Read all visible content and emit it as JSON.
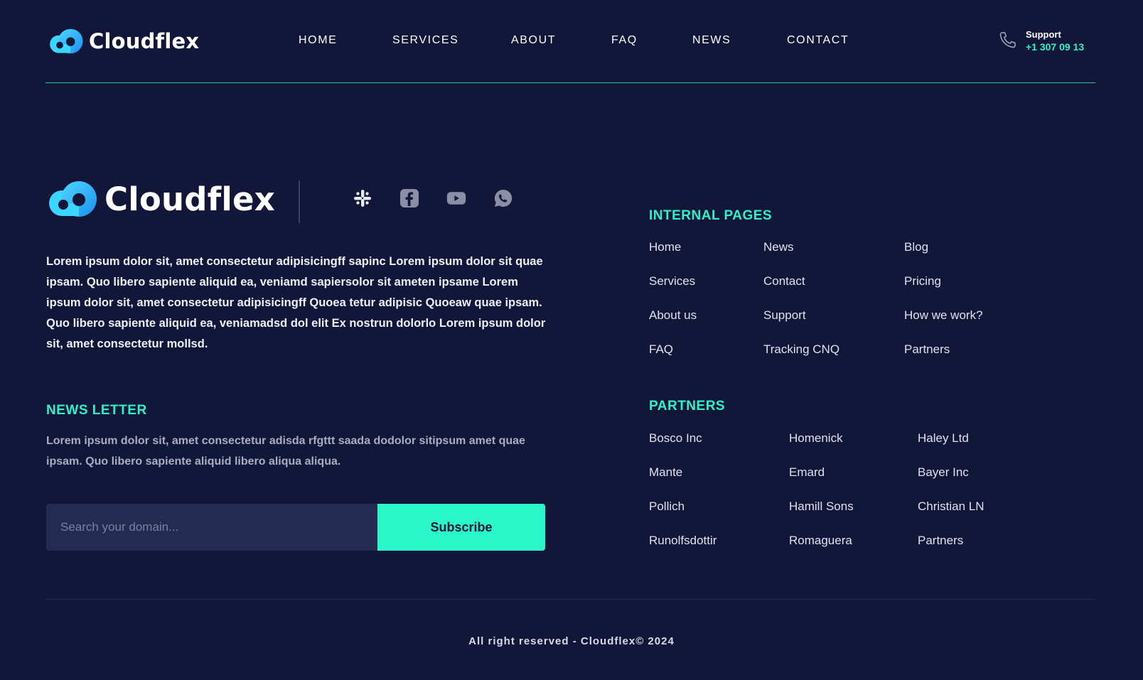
{
  "brand": {
    "name": "Cloudflex",
    "colors": {
      "background": "#12173a",
      "accent": "#2ef2c6",
      "button": "#2af7c9",
      "input_bg": "#222b52"
    }
  },
  "nav": {
    "items": [
      {
        "label": "HOME"
      },
      {
        "label": "SERVICES"
      },
      {
        "label": "ABOUT"
      },
      {
        "label": "FAQ"
      },
      {
        "label": "NEWS"
      },
      {
        "label": "CONTACT"
      }
    ]
  },
  "support": {
    "icon": "phone-icon",
    "label": "Support",
    "phone": "+1 307 09 13"
  },
  "footer": {
    "socials": [
      {
        "icon": "slack-icon"
      },
      {
        "icon": "facebook-icon"
      },
      {
        "icon": "youtube-icon"
      },
      {
        "icon": "whatsapp-icon"
      }
    ],
    "about_text": "Lorem ipsum dolor sit, amet consectetur adipisicingff sapinc Lorem ipsum dolor sit quae ipsam. Quo libero sapiente aliquid ea, veniamd sapiersolor sit ameten ipsame Lorem ipsum dolor sit, amet consectetur adipisicingff Quoea tetur adipisic Quoeaw quae ipsam. Quo libero sapiente aliquid ea, veniamadsd dol elit Ex nostrun dolorlo Lorem ipsum dolor sit, amet consectetur mollsd.",
    "newsletter": {
      "heading": "NEWS LETTER",
      "text": "Lorem ipsum dolor sit, amet consectetur adisda rfgttt saada dodolor sitipsum amet quae ipsam. Quo libero sapiente aliquid libero aliqua aliqua.",
      "placeholder": "Search your domain...",
      "button_label": "Subscribe"
    },
    "internal_pages": {
      "heading": "INTERNAL PAGES",
      "columns": [
        [
          "Home",
          "Services",
          "About us",
          "FAQ"
        ],
        [
          "News",
          "Contact",
          "Support",
          "Tracking CNQ"
        ],
        [
          "Blog",
          "Pricing",
          "How we work?",
          "Partners"
        ]
      ]
    },
    "partners": {
      "heading": "PARTNERS",
      "columns": [
        [
          "Bosco Inc",
          "Mante",
          "Pollich",
          "Runolfsdottir"
        ],
        [
          "Homenick",
          "Emard",
          "Hamill Sons",
          "Romaguera"
        ],
        [
          "Haley Ltd",
          "Bayer Inc",
          "Christian LN",
          "Partners"
        ]
      ]
    },
    "copyright": "All right reserved - Cloudflex© 2024"
  }
}
